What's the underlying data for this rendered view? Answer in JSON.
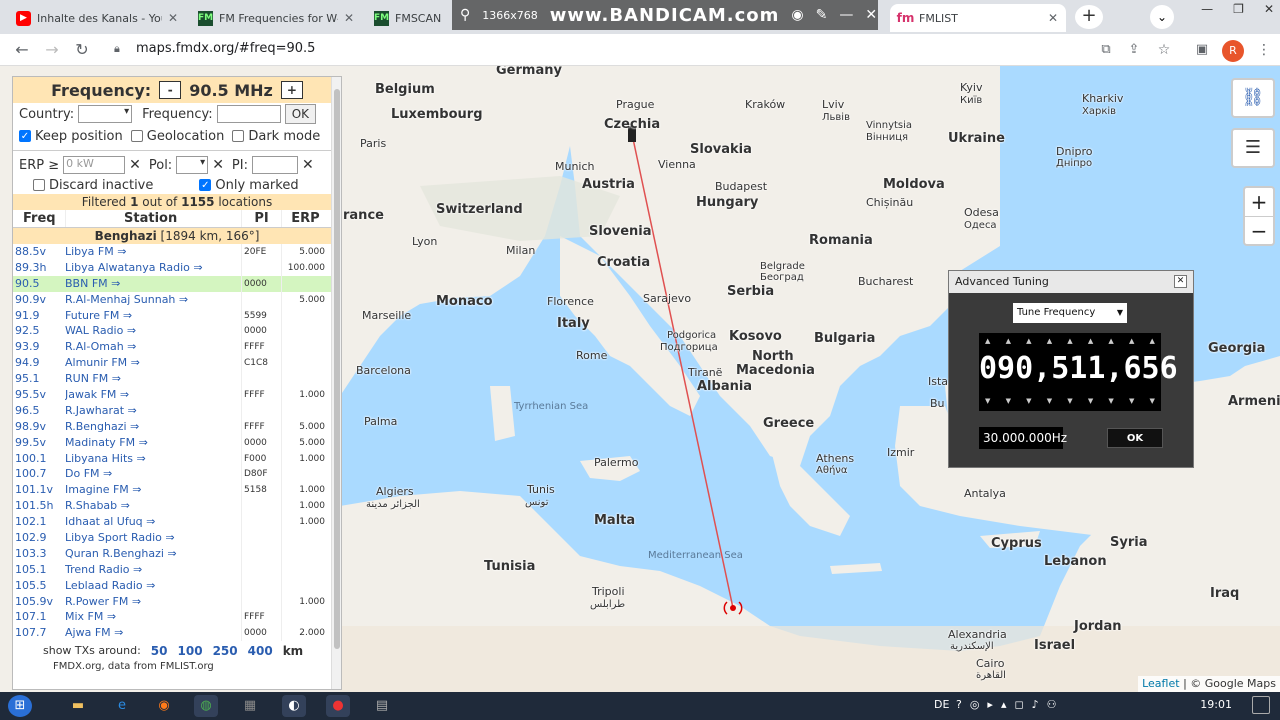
{
  "browser": {
    "tabs": [
      {
        "title": "Inhalte des Kanals - YouTube",
        "icon": "youtube-icon",
        "color": "#ff0000"
      },
      {
        "title": "FM Frequencies for W4",
        "icon": "fm-scan-icon",
        "color": "#1a4d2e"
      },
      {
        "title": "FMSCAN",
        "icon": "fm-scan-icon",
        "color": "#1a4d2e"
      },
      {
        "title": "FMLIST",
        "icon": "fmlist-icon",
        "color": "#d6336c"
      }
    ],
    "url": "maps.fmdx.org/#freq=90.5",
    "avatar_letter": "R",
    "recording": {
      "resolution": "1366x768",
      "brand": "www.BANDICAM.com"
    }
  },
  "panel": {
    "frequency_label": "Frequency:",
    "frequency_value": "90.5 MHz",
    "minus": "-",
    "plus": "+",
    "country_label": "Country:",
    "frequency_field_label": "Frequency:",
    "ok_label": "OK",
    "keep_position": "Keep position",
    "geolocation": "Geolocation",
    "dark_mode": "Dark mode",
    "erp_label": "ERP ≥",
    "erp_placeholder": "0 kW",
    "pol_label": "Pol:",
    "pi_label": "PI:",
    "discard_inactive": "Discard inactive",
    "only_marked": "Only marked",
    "filtered_pre": "Filtered ",
    "filtered_count": "1",
    "filtered_mid": " out of ",
    "filtered_total": "1155",
    "filtered_post": " locations",
    "headers": {
      "freq": "Freq",
      "station": "Station",
      "pi": "PI",
      "erp": "ERP"
    },
    "location_name": "Benghazi",
    "location_detail": " [1894 km, 166°]",
    "rows": [
      {
        "freq": "88.5v",
        "station": "Libya FM ⇒",
        "pi": "20FE",
        "erp": "5.000"
      },
      {
        "freq": "89.3h",
        "station": "Libya Alwatanya Radio ⇒",
        "pi": "",
        "erp": "100.000"
      },
      {
        "freq": "90.5",
        "station": "BBN FM ⇒",
        "pi": "0000",
        "erp": ""
      },
      {
        "freq": "90.9v",
        "station": "R.Al-Menhaj Sunnah ⇒",
        "pi": "",
        "erp": "5.000"
      },
      {
        "freq": "91.9",
        "station": "Future FM ⇒",
        "pi": "5599",
        "erp": ""
      },
      {
        "freq": "92.5",
        "station": "WAL Radio ⇒",
        "pi": "0000",
        "erp": ""
      },
      {
        "freq": "93.9",
        "station": "R.Al-Omah ⇒",
        "pi": "FFFF",
        "erp": ""
      },
      {
        "freq": "94.9",
        "station": "Almunir FM ⇒",
        "pi": "C1C8",
        "erp": ""
      },
      {
        "freq": "95.1",
        "station": "RUN FM ⇒",
        "pi": "",
        "erp": ""
      },
      {
        "freq": "95.5v",
        "station": "Jawak FM ⇒",
        "pi": "FFFF",
        "erp": "1.000"
      },
      {
        "freq": "96.5",
        "station": "R.Jawharat ⇒",
        "pi": "",
        "erp": ""
      },
      {
        "freq": "98.9v",
        "station": "R.Benghazi ⇒",
        "pi": "FFFF",
        "erp": "5.000"
      },
      {
        "freq": "99.5v",
        "station": "Madinaty FM ⇒",
        "pi": "0000",
        "erp": "5.000"
      },
      {
        "freq": "100.1",
        "station": "Libyana Hits ⇒",
        "pi": "F000",
        "erp": "1.000"
      },
      {
        "freq": "100.7",
        "station": "Do FM ⇒",
        "pi": "D80F",
        "erp": ""
      },
      {
        "freq": "101.1v",
        "station": "Imagine FM ⇒",
        "pi": "5158",
        "erp": "1.000"
      },
      {
        "freq": "101.5h",
        "station": "R.Shabab ⇒",
        "pi": "",
        "erp": "1.000"
      },
      {
        "freq": "102.1",
        "station": "Idhaat al Ufuq ⇒",
        "pi": "",
        "erp": "1.000"
      },
      {
        "freq": "102.9",
        "station": "Libya Sport Radio ⇒",
        "pi": "",
        "erp": ""
      },
      {
        "freq": "103.3",
        "station": "Quran R.Benghazi ⇒",
        "pi": "",
        "erp": ""
      },
      {
        "freq": "105.1",
        "station": "Trend Radio ⇒",
        "pi": "",
        "erp": ""
      },
      {
        "freq": "105.5",
        "station": "Leblaad Radio ⇒",
        "pi": "",
        "erp": ""
      },
      {
        "freq": "105.9v",
        "station": "R.Power FM ⇒",
        "pi": "",
        "erp": "1.000"
      },
      {
        "freq": "107.1",
        "station": "Mix FM ⇒",
        "pi": "FFFF",
        "erp": ""
      },
      {
        "freq": "107.7",
        "station": "Ajwa FM ⇒",
        "pi": "0000",
        "erp": "2.000"
      }
    ],
    "show_tx_label": "show TXs around:",
    "distances": [
      "50",
      "100",
      "250",
      "400"
    ],
    "distance_unit": "km",
    "footnote": "FMDX.org, data from FMLIST.org"
  },
  "advanced_tuning": {
    "title": "Advanced Tuning",
    "mode": "Tune Frequency",
    "digits": "090,511,656",
    "step": "30.000.000Hz",
    "ok": "OK"
  },
  "map": {
    "labels": {
      "germany": "Germany",
      "belgium": "Belgium",
      "luxembourg": "Luxembourg",
      "paris": "Paris",
      "prague": "Prague",
      "czechia": "Czechia",
      "krakow": "Kraków",
      "lviv": "Lviv",
      "lviv_cyr": "Львів",
      "kyiv": "Kyiv",
      "kyiv_cyr": "Київ",
      "kharkiv": "Kharkiv",
      "kharkiv_cyr": "Харків",
      "vinnytsia": "Vinnytsia",
      "vinnytsia_cyr": "Вінниця",
      "ukraine": "Ukraine",
      "slovakia": "Slovakia",
      "munich": "Munich",
      "vienna": "Vienna",
      "austria": "Austria",
      "dnipro": "Dnipro",
      "dnipro_cyr": "Дніпро",
      "budapest": "Budapest",
      "moldova": "Moldova",
      "france": "rance",
      "switzerland": "Switzerland",
      "hungary": "Hungary",
      "chisinau": "Chișinău",
      "odesa": "Odesa",
      "odesa_cyr": "Одеса",
      "lyon": "Lyon",
      "slovenia": "Slovenia",
      "romania": "Romania",
      "milan": "Milan",
      "croatia": "Croatia",
      "belgrade": "Belgrade",
      "belgrade_cyr": "Београд",
      "bucharest": "Bucharest",
      "monaco": "Monaco",
      "florence": "Florence",
      "sarajevo": "Sarajevo",
      "serbia": "Serbia",
      "marseille": "Marseille",
      "italy": "Italy",
      "podgorica": "Podgorica",
      "podgorica_cyr": "Подгорица",
      "kosovo": "Kosovo",
      "bulgaria": "Bulgaria",
      "rome": "Rome",
      "tirane": "Tiranë",
      "north": "North",
      "macedonia": "Macedonia",
      "georgia": "Georgia",
      "barcelona": "Barcelona",
      "albania": "Albania",
      "istanbul": "Ista",
      "armenia": "Armeni",
      "tyrrhenian": "Tyrrhenian Sea",
      "greece": "Greece",
      "bursa": "Bu",
      "palma": "Palma",
      "athens": "Athens",
      "athens_gr": "Αθήνα",
      "izmir": "Izmir",
      "palermo": "Palermo",
      "algiers": "Algiers",
      "algiers_ar": "الجزائر مدينة",
      "tunis": "Tunis",
      "tunis_ar": "تونس",
      "antalya": "Antalya",
      "malta": "Malta",
      "cyprus": "Cyprus",
      "syria": "Syria",
      "med_sea": "Mediterranean Sea",
      "tunisia": "Tunisia",
      "lebanon": "Lebanon",
      "tripoli": "Tripoli",
      "tripoli_ar": "طرابلس",
      "iraq": "Iraq",
      "jordan": "Jordan",
      "alexandria": "Alexandria",
      "alexandria_ar": "الإسكندرية",
      "israel": "Israel",
      "cairo": "Cairo",
      "cairo_ar": "القاهرة"
    },
    "attribution_leaflet": "Leaflet",
    "attribution_rest": "| © Google Maps",
    "zoom_in": "+",
    "zoom_out": "−"
  },
  "taskbar": {
    "language": "DE",
    "time": "19:01"
  },
  "colors": {
    "sea": "#aadaff",
    "land": "#f2efe9",
    "line": "#e05050",
    "highlight_row": "#d4f5c0",
    "header_bg": "#ffe5b4"
  }
}
